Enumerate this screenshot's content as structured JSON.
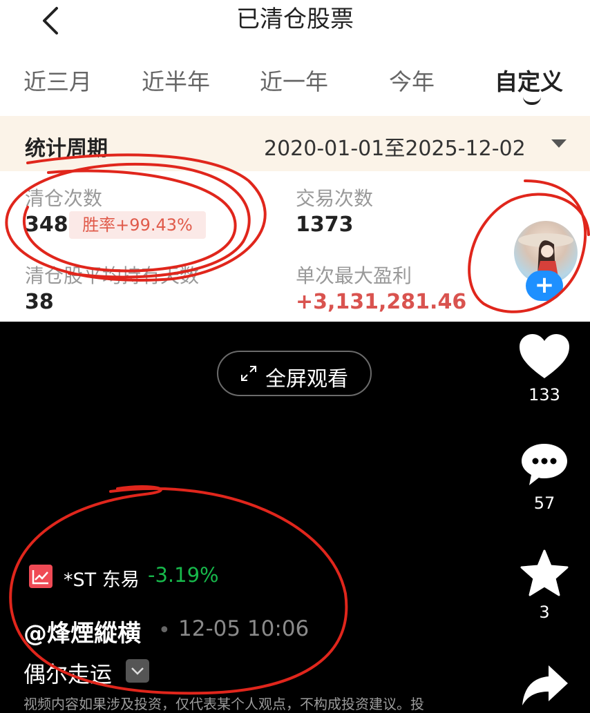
{
  "header": {
    "title": "已清仓股票"
  },
  "tabs": [
    {
      "label": "近三月"
    },
    {
      "label": "近半年"
    },
    {
      "label": "近一年"
    },
    {
      "label": "今年"
    },
    {
      "label": "自定义",
      "active": true
    }
  ],
  "period": {
    "label": "统计周期",
    "range": "2020-01-01至2025-12-02"
  },
  "stats": {
    "clear_count": {
      "label": "清仓次数",
      "value": "348",
      "winrate": "胜率+99.43%"
    },
    "trade_count": {
      "label": "交易次数",
      "value": "1373"
    },
    "avg_hold": {
      "label": "清仓股平均持有天数",
      "value": "38"
    },
    "max_profit": {
      "label": "单次最大盈利",
      "value": "+3,131,281.46"
    }
  },
  "video": {
    "fullscreen_label": "全屏观看"
  },
  "rail": {
    "likes": "133",
    "comments": "57",
    "favorites": "3"
  },
  "post": {
    "stock_name": "*ST 东易",
    "stock_change": "-3.19%",
    "author": "@烽煙縱横",
    "time": "12-05 10:06",
    "description": "偶尔走运",
    "disclaimer": "视频内容如果涉及投资，仅代表某个人观点，不构成投资建议。投"
  },
  "colors": {
    "profit": "#d9534f",
    "loss_green": "#17b84b",
    "follow": "#1e90ff",
    "stock_icon": "#ef4a55"
  }
}
